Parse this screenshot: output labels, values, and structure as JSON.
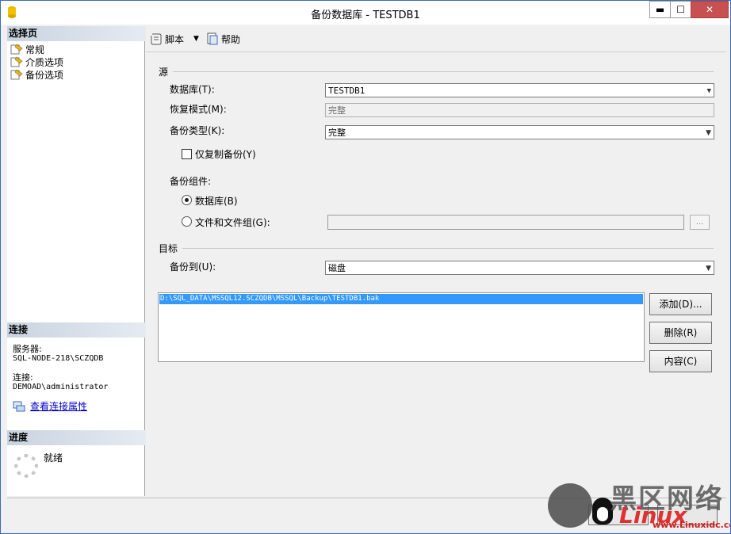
{
  "window": {
    "title": "备份数据库 - TESTDB1",
    "minimize_glyph": "▬",
    "maximize_glyph": "☐",
    "close_glyph": "✕"
  },
  "left_panel": {
    "select_page_header": "选择页",
    "pages": [
      {
        "label": "常规",
        "icon": "page-icon"
      },
      {
        "label": "介质选项",
        "icon": "page-icon"
      },
      {
        "label": "备份选项",
        "icon": "page-icon"
      }
    ],
    "connection_header": "连接",
    "server_label": "服务器:",
    "server_value": "SQL-NODE-218\\SCZQDB",
    "connection_label": "连接:",
    "connection_value": "DEMOAD\\administrator",
    "view_connection_link": "查看连接属性",
    "progress_header": "进度",
    "progress_status": "就绪"
  },
  "toolbar": {
    "script_label": "脚本",
    "help_label": "帮助"
  },
  "source": {
    "group_label": "源",
    "database_label": "数据库(T):",
    "database_value": "TESTDB1",
    "recovery_model_label": "恢复模式(M):",
    "recovery_model_value": "完整",
    "backup_type_label": "备份类型(K):",
    "backup_type_value": "完整",
    "copy_only_label": "仅复制备份(Y)",
    "copy_only_checked": false,
    "backup_component_label": "备份组件:",
    "component_database_label": "数据库(B)",
    "component_database_selected": true,
    "component_files_label": "文件和文件组(G):",
    "component_files_selected": false,
    "browse_label": "..."
  },
  "destination": {
    "group_label": "目标",
    "backup_to_label": "备份到(U):",
    "backup_to_value": "磁盘",
    "files": [
      "D:\\SQL_DATA\\MSSQL12.SCZQDB\\MSSQL\\Backup\\TESTDB1.bak"
    ],
    "add_button": "添加(D)...",
    "remove_button": "删除(R)",
    "contents_button": "内容(C)"
  },
  "watermark": {
    "title": "黑区网络",
    "linux": "Linux",
    "url": "www.Linuxidc.com"
  }
}
